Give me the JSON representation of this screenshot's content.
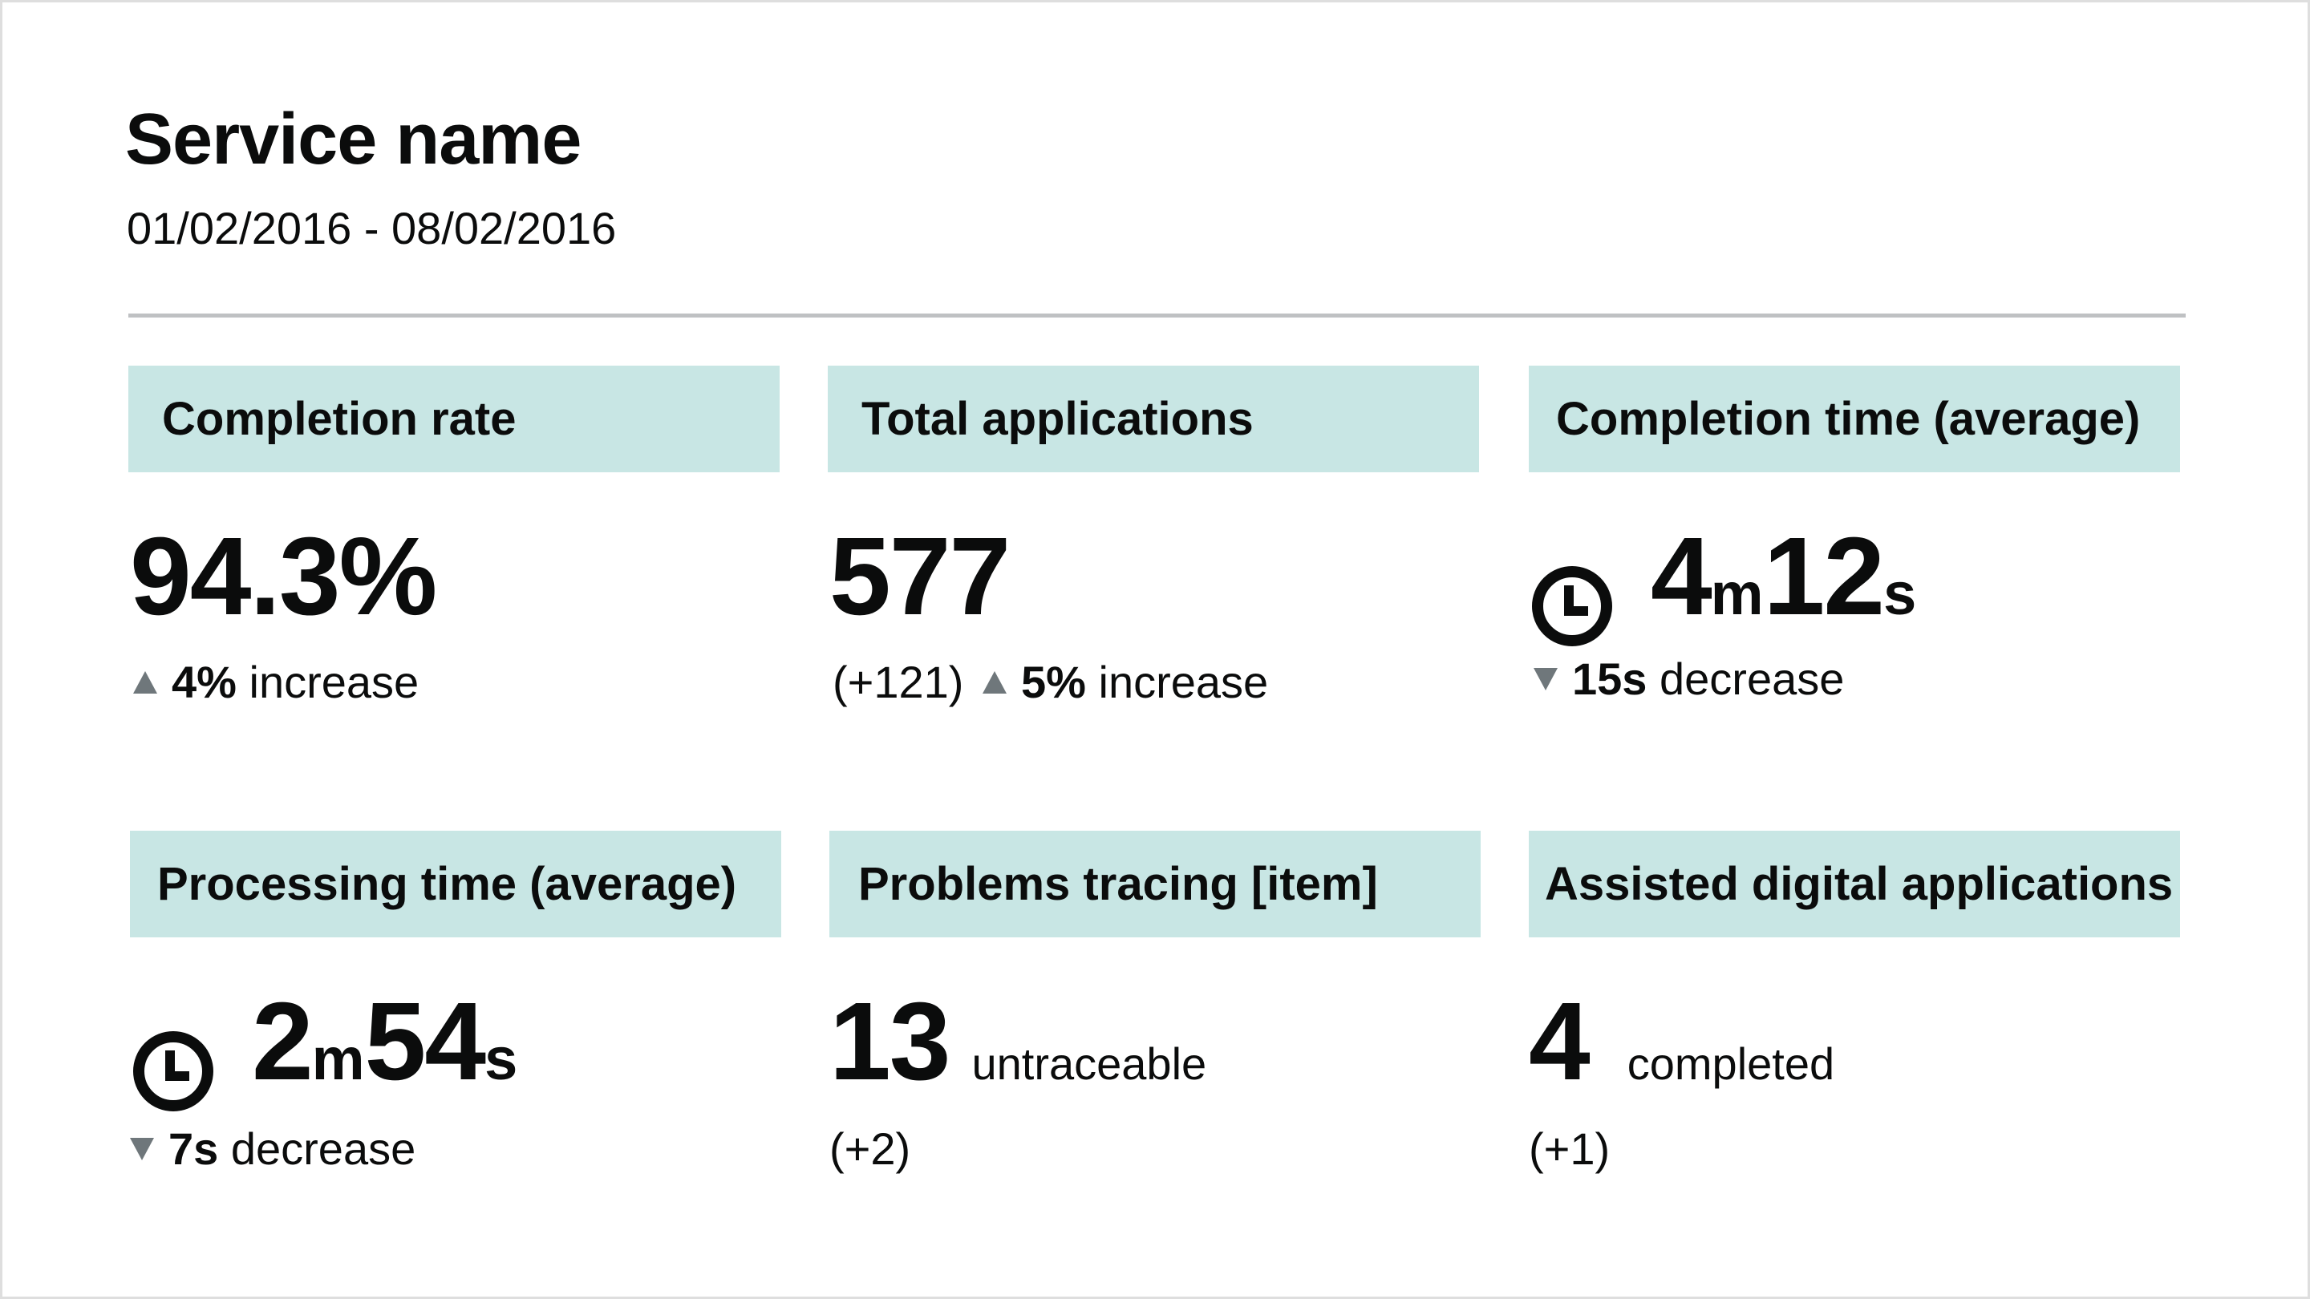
{
  "header": {
    "title": "Service name",
    "date_range": "01/02/2016 - 08/02/2016"
  },
  "colors": {
    "card_header_bg": "#c8e6e4",
    "arrow": "#6f777b",
    "rule": "#bfc1c3"
  },
  "cards": [
    {
      "title": "Completion rate",
      "value": "94.3%",
      "change_icon": "triangle-up-icon",
      "change_value": "4%",
      "change_text": "increase"
    },
    {
      "title": "Total applications",
      "value": "577",
      "prefix": "(+121)",
      "change_icon": "triangle-up-icon",
      "change_value": "5%",
      "change_text": "increase"
    },
    {
      "title": "Completion time (average)",
      "icon": "clock-icon",
      "minutes": "4",
      "minutes_unit": "m",
      "seconds": "12",
      "seconds_unit": "s",
      "change_icon": "triangle-down-icon",
      "change_value": "15s",
      "change_text": "decrease"
    },
    {
      "title": "Processing time (average)",
      "icon": "clock-icon",
      "minutes": "2",
      "minutes_unit": "m",
      "seconds": "54",
      "seconds_unit": "s",
      "change_icon": "triangle-down-icon",
      "change_value": "7s",
      "change_text": "decrease"
    },
    {
      "title": "Problems tracing [item]",
      "value": "13",
      "value_suffix": "untraceable",
      "detail": "(+2)"
    },
    {
      "title": "Assisted digital applications",
      "value": "4",
      "value_suffix": "completed",
      "detail": "(+1)"
    }
  ]
}
